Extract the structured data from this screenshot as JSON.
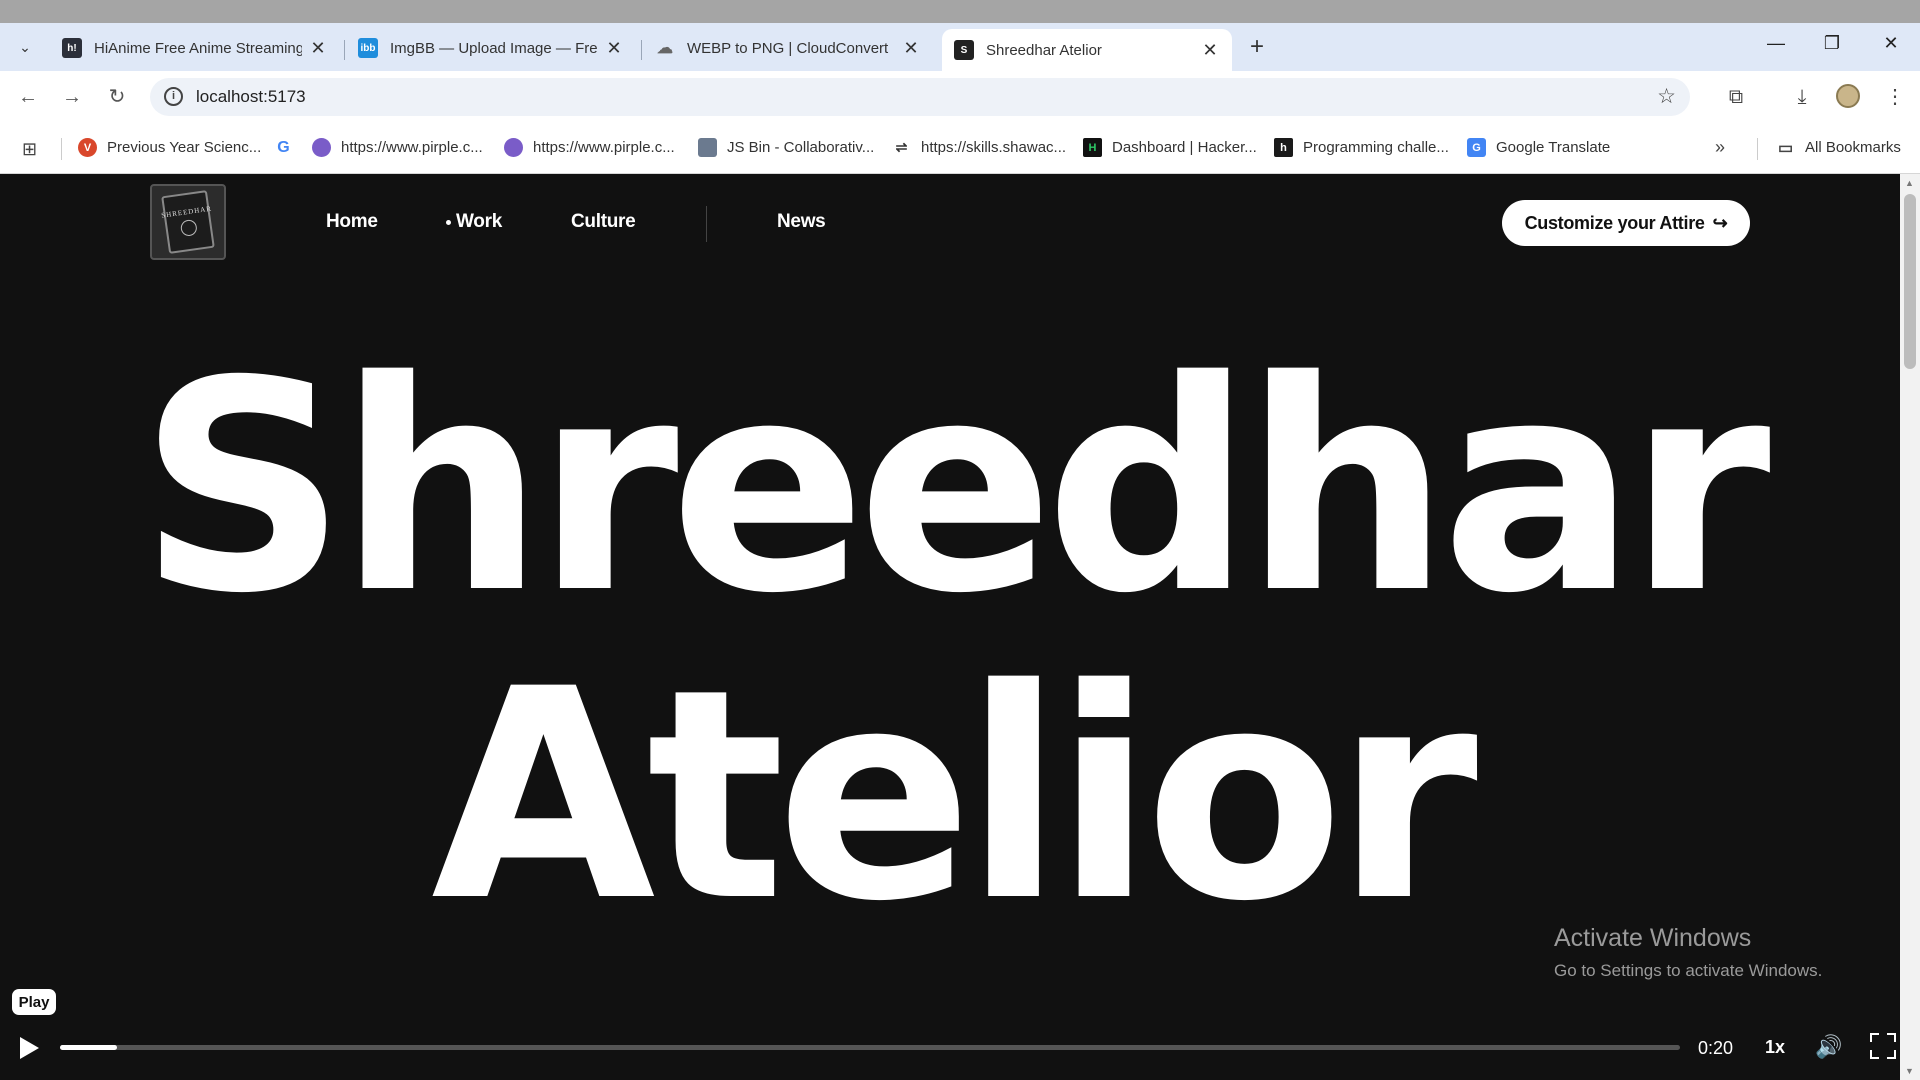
{
  "browser": {
    "tabs": [
      {
        "label": "HiAnime Free Anime Streaming",
        "favicon": "H",
        "favicon_color": "#2b2f3a"
      },
      {
        "label": "ImgBB — Upload Image — Fre",
        "favicon": "ibb",
        "favicon_color": "#1f8ddc"
      },
      {
        "label": "WEBP to PNG | CloudConvert",
        "favicon": "cloud",
        "favicon_color": "#8a8f98"
      },
      {
        "label": "Shreedhar Atelior",
        "favicon": "S",
        "favicon_color": "#222222"
      }
    ],
    "active_tab": 3,
    "address": "localhost:5173",
    "bookmarks": [
      {
        "label": "Previous Year Scienc...",
        "color": "#d9472b",
        "glyph": "V"
      },
      {
        "label": "",
        "color": "#4285f4",
        "glyph": "G"
      },
      {
        "label": "https://www.pirple.c...",
        "color": "#7a5cc8",
        "glyph": ""
      },
      {
        "label": "https://www.pirple.c...",
        "color": "#7a5cc8",
        "glyph": ""
      },
      {
        "label": "JS Bin - Collaborativ...",
        "color": "#6b7a8f",
        "glyph": ""
      },
      {
        "label": "https://skills.shawac...",
        "color": "#333333",
        "glyph": "⇌"
      },
      {
        "label": "Dashboard | Hacker...",
        "color": "#111111",
        "glyph": "H"
      },
      {
        "label": "Programming challe...",
        "color": "#1a1a1a",
        "glyph": "h"
      },
      {
        "label": "Google Translate",
        "color": "#4285f4",
        "glyph": "G"
      }
    ],
    "all_bookmarks": "All Bookmarks"
  },
  "site": {
    "nav": {
      "home": "Home",
      "work": "Work",
      "culture": "Culture",
      "news": "News"
    },
    "cta": "Customize your Attire",
    "cta_arrow": "↪",
    "hero_line1": "Shreedhar",
    "hero_line2": "Atelior",
    "logo_text": "SHREEDHAR"
  },
  "watermark": {
    "title": "Activate Windows",
    "subtitle": "Go to Settings to activate Windows."
  },
  "player": {
    "tooltip": "Play",
    "time": "0:20",
    "speed": "1x",
    "progress_fraction": 0.035
  }
}
